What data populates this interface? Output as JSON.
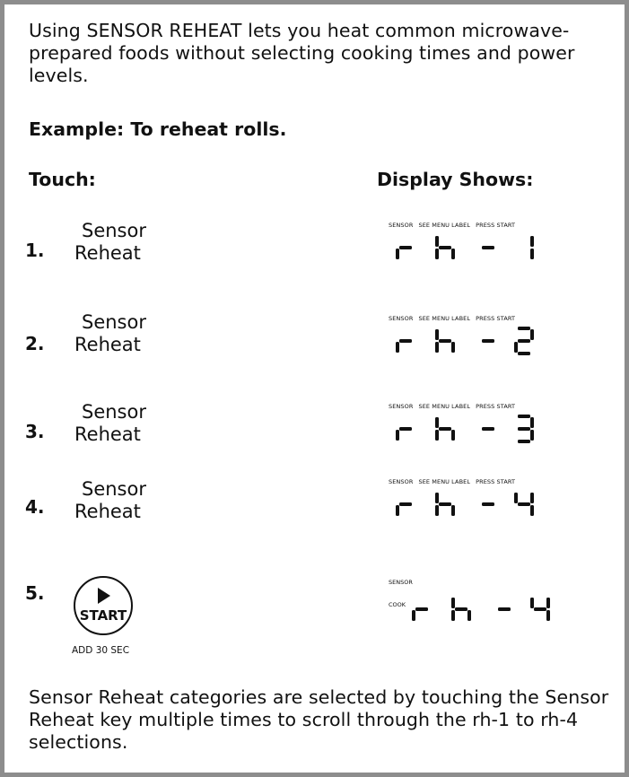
{
  "intro": "Using SENSOR REHEAT lets you heat common microwave-prepared foods without selecting cooking times and power levels.",
  "example": "Example: To reheat rolls.",
  "touch_label": "Touch:",
  "display_label": "Display Shows:",
  "steps": [
    {
      "num": "1.",
      "key_line1": "Sensor",
      "key_line2": "Reheat",
      "indicators": [
        "SENSOR",
        "SEE MENU LABEL",
        "PRESS START"
      ],
      "display": "rh -1"
    },
    {
      "num": "2.",
      "key_line1": "Sensor",
      "key_line2": "Reheat",
      "indicators": [
        "SENSOR",
        "SEE MENU LABEL",
        "PRESS START"
      ],
      "display": "rh -2"
    },
    {
      "num": "3.",
      "key_line1": "Sensor",
      "key_line2": "Reheat",
      "indicators": [
        "SENSOR",
        "SEE MENU LABEL",
        "PRESS START"
      ],
      "display": "rh -3"
    },
    {
      "num": "4.",
      "key_line1": "Sensor",
      "key_line2": "Reheat",
      "indicators": [
        "SENSOR",
        "SEE MENU LABEL",
        "PRESS START"
      ],
      "display": "rh -4"
    }
  ],
  "step5": {
    "num": "5.",
    "key_label": "START",
    "key_sublabel": "ADD 30 SEC",
    "indicator_top": "SENSOR",
    "indicator_side": "COOK",
    "display": "rh -4"
  },
  "outro": "Sensor Reheat categories are selected by touching the Sensor Reheat key multiple times to scroll through the rh-1 to rh-4 selections."
}
